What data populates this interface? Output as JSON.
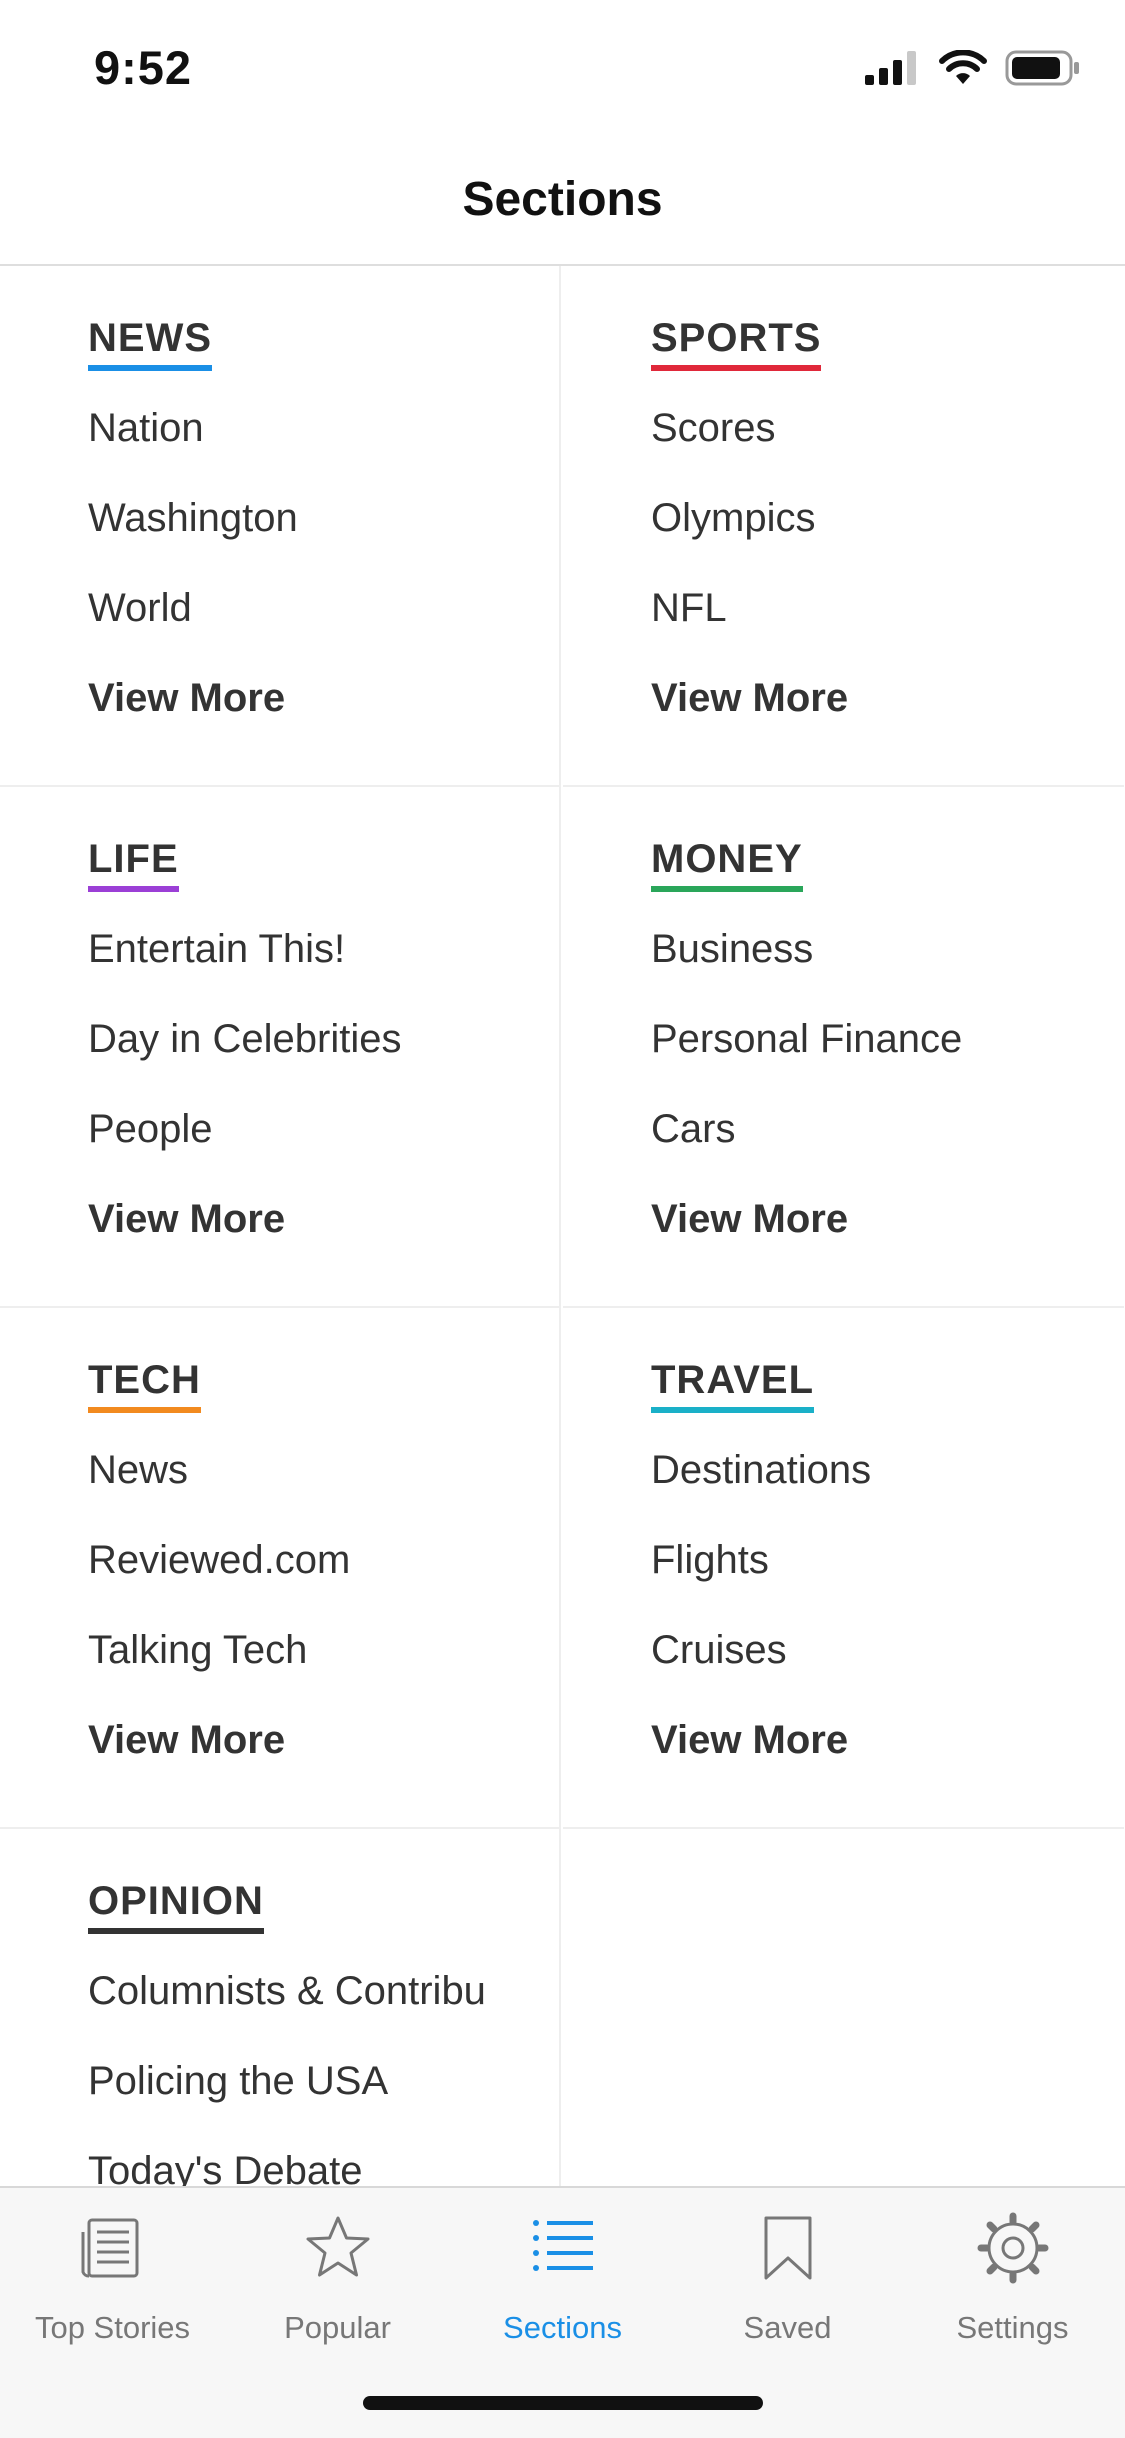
{
  "status_bar": {
    "time": "9:52"
  },
  "nav": {
    "title": "Sections"
  },
  "sections": [
    {
      "heading": "NEWS",
      "color": "#1a8fe6",
      "items": [
        "Nation",
        "Washington",
        "World"
      ],
      "more": "View More"
    },
    {
      "heading": "SPORTS",
      "color": "#e0283a",
      "items": [
        "Scores",
        "Olympics",
        "NFL"
      ],
      "more": "View More"
    },
    {
      "heading": "LIFE",
      "color": "#9b3fd6",
      "items": [
        "Entertain This!",
        "Day in Celebrities",
        "People"
      ],
      "more": "View More"
    },
    {
      "heading": "MONEY",
      "color": "#2aa65a",
      "items": [
        "Business",
        "Personal Finance",
        "Cars"
      ],
      "more": "View More"
    },
    {
      "heading": "TECH",
      "color": "#f28a1f",
      "items": [
        "News",
        "Reviewed.com",
        "Talking Tech"
      ],
      "more": "View More"
    },
    {
      "heading": "TRAVEL",
      "color": "#1ab0c8",
      "items": [
        "Destinations",
        "Flights",
        "Cruises"
      ],
      "more": "View More"
    },
    {
      "heading": "OPINION",
      "color": "#333333",
      "items": [
        "Columnists & Contribu",
        "Policing the USA",
        "Today's Debate"
      ]
    }
  ],
  "tabs": [
    {
      "label": "Top Stories",
      "icon": "newspaper-icon"
    },
    {
      "label": "Popular",
      "icon": "star-icon"
    },
    {
      "label": "Sections",
      "icon": "list-icon",
      "active": true
    },
    {
      "label": "Saved",
      "icon": "bookmark-icon"
    },
    {
      "label": "Settings",
      "icon": "gear-icon"
    }
  ],
  "colors": {
    "accent": "#1a8fe6",
    "tab_inactive": "#777777"
  }
}
